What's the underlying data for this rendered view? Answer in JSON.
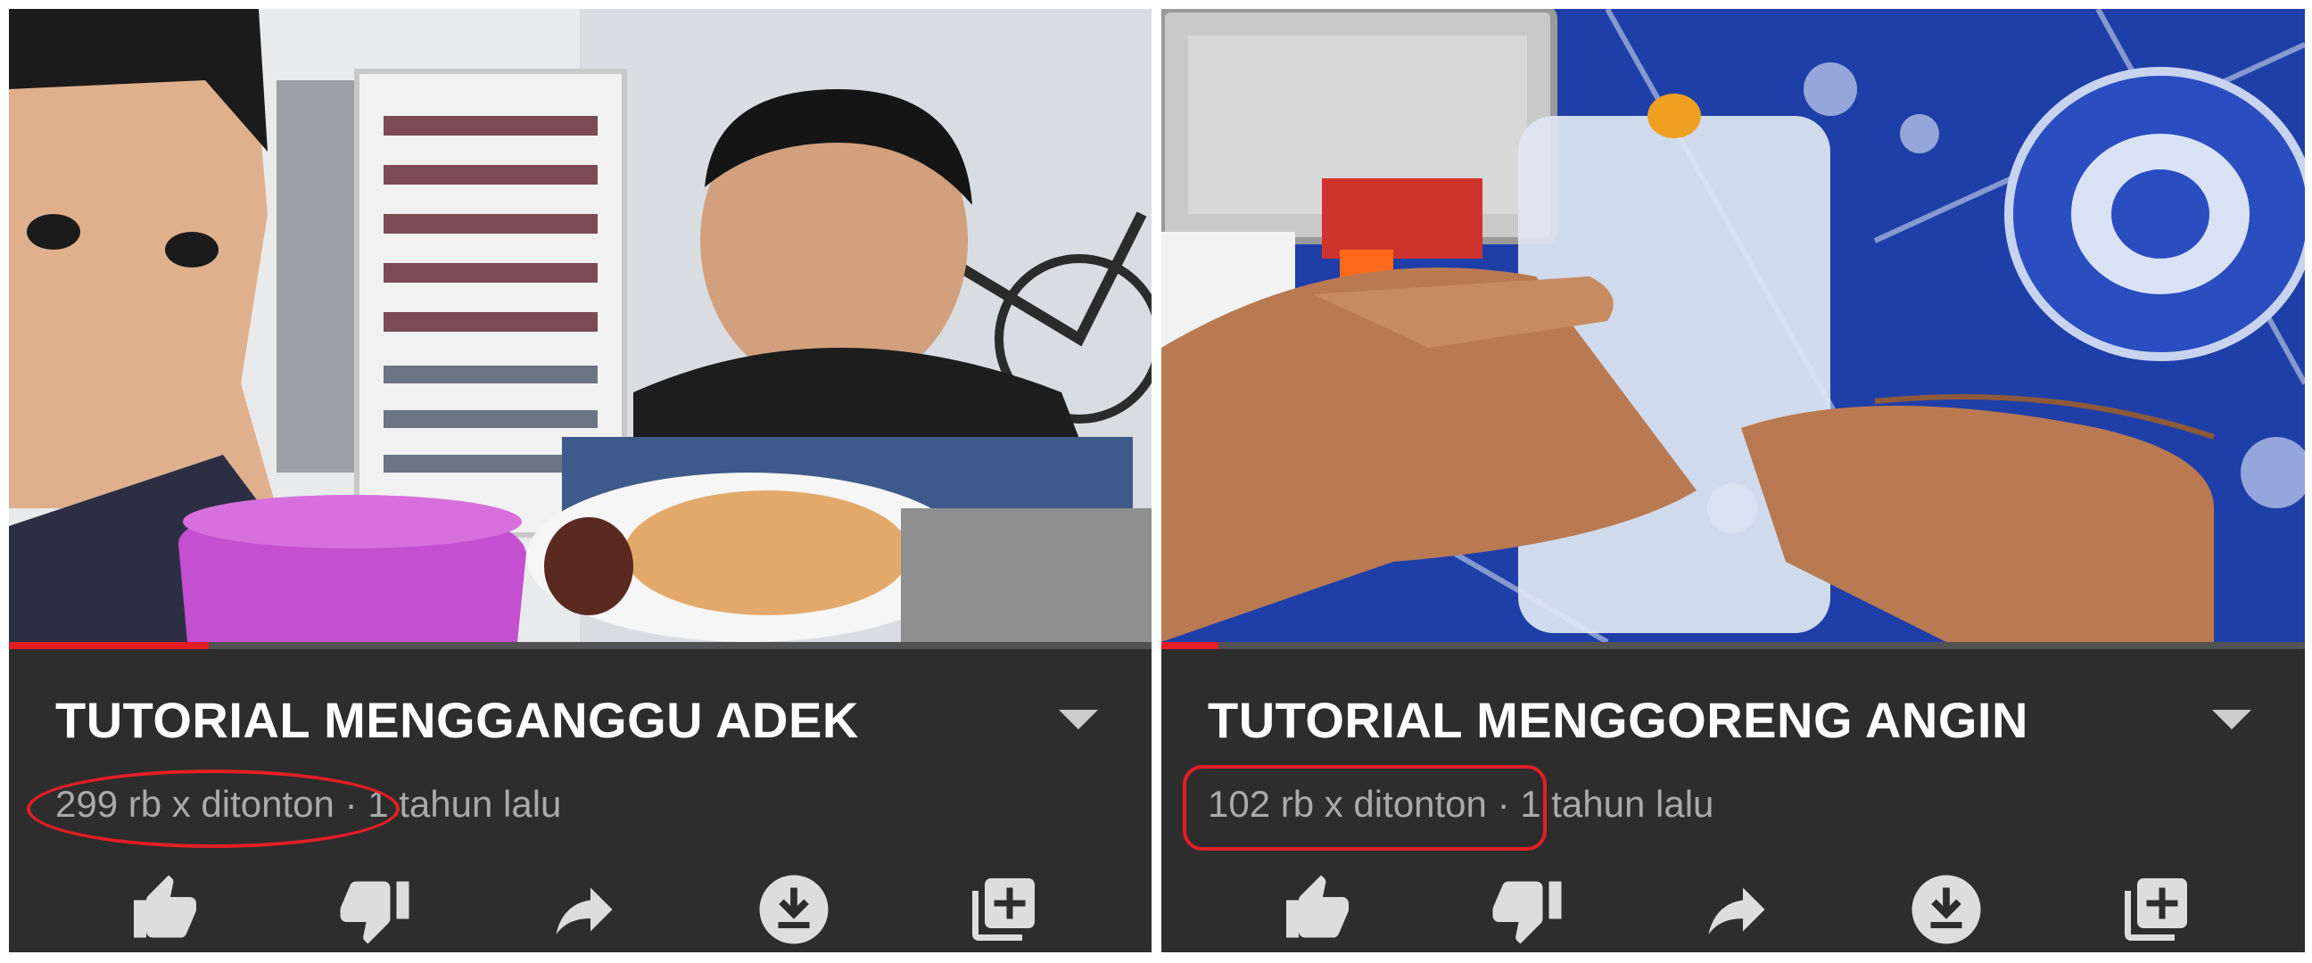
{
  "colors": {
    "panel_bg": "#2d2d2d",
    "title_text": "#ffffff",
    "meta_text": "#aaaaaa",
    "icon": "#dddddd",
    "progress_played": "#e31e24",
    "highlight": "#e31e24"
  },
  "videos": [
    {
      "title": "TUTORIAL MENGGANGGU ADEK",
      "views": "299 rb x ditonton",
      "separator": "·",
      "age": "1 tahun lalu",
      "progress_fraction": 0.175,
      "highlight_shape": "ellipse",
      "thumbnail_description_icon": "video-frame",
      "actions": [
        "like-icon",
        "dislike-icon",
        "share-icon",
        "download-icon",
        "add-to-playlist-icon"
      ]
    },
    {
      "title": "TUTORIAL MENGGORENG ANGIN",
      "views": "102 rb x ditonton",
      "separator": "·",
      "age": "1 tahun lalu",
      "progress_fraction": 0.05,
      "highlight_shape": "rounded-rectangle",
      "thumbnail_description_icon": "video-frame",
      "actions": [
        "like-icon",
        "dislike-icon",
        "share-icon",
        "download-icon",
        "add-to-playlist-icon"
      ]
    }
  ]
}
